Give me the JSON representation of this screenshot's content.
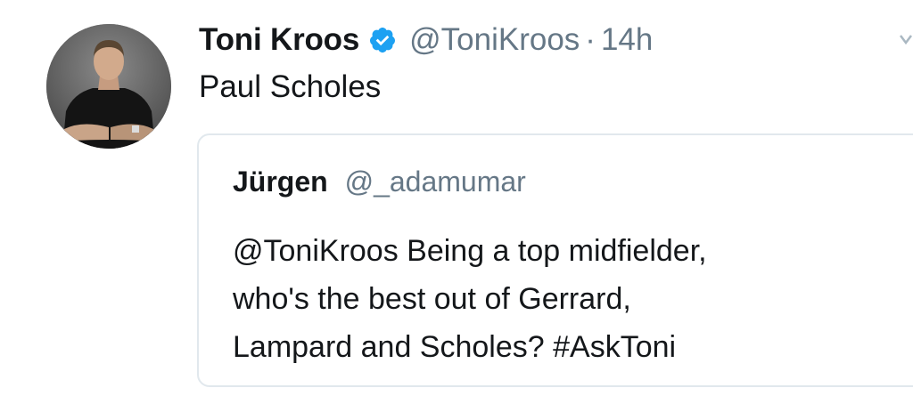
{
  "tweet": {
    "author_name": "Toni Kroos",
    "author_handle": "@ToniKroos",
    "separator": "·",
    "time": "14h",
    "text": "Paul Scholes"
  },
  "quoted_tweet": {
    "author_name": "Jürgen",
    "author_handle": "@_adamumar",
    "text_lines": [
      "@ToniKroos Being a top midfielder,",
      "who's the best out of Gerrard,",
      "Lampard and Scholes? #AskToni"
    ]
  },
  "colors": {
    "text_primary": "#14171a",
    "text_secondary": "#657786",
    "verified_blue": "#1da1f2",
    "card_border": "#e1e8ed"
  },
  "icons": {
    "verified": "verified-badge-icon",
    "caret": "chevron-down-icon"
  }
}
